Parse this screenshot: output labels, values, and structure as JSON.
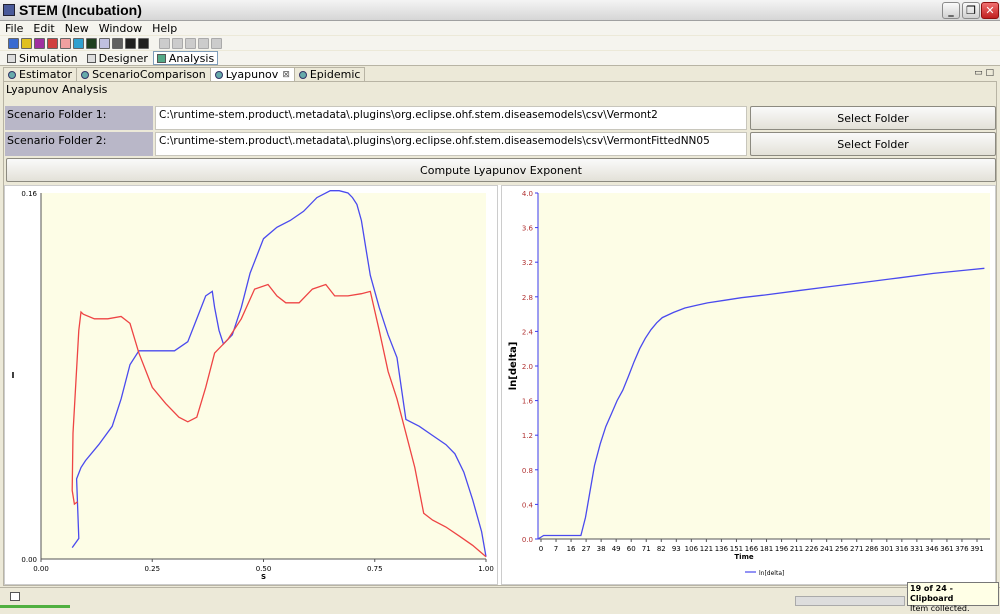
{
  "window": {
    "title": "STEM (Incubation)"
  },
  "menubar": {
    "items": [
      "File",
      "Edit",
      "New",
      "Window",
      "Help"
    ]
  },
  "perspectives": [
    {
      "label": "Simulation",
      "active": false
    },
    {
      "label": "Designer",
      "active": false
    },
    {
      "label": "Analysis",
      "active": true
    }
  ],
  "view_tabs": [
    {
      "label": "Estimator",
      "active": false
    },
    {
      "label": "ScenarioComparison",
      "active": false
    },
    {
      "label": "Lyapunov",
      "active": true
    },
    {
      "label": "Epidemic",
      "active": false
    }
  ],
  "panel": {
    "title": "Lyapunov Analysis",
    "folder1_label": "Scenario Folder 1:",
    "folder1_path": "C:\\runtime-stem.product\\.metadata\\.plugins\\org.eclipse.ohf.stem.diseasemodels\\csv\\Vermont2",
    "folder2_label": "Scenario Folder 2:",
    "folder2_path": "C:\\runtime-stem.product\\.metadata\\.plugins\\org.eclipse.ohf.stem.diseasemodels\\csv\\VermontFittedNN05",
    "select_folder_label": "Select Folder",
    "compute_label": "Compute Lyapunov Exponent"
  },
  "chart_data": [
    {
      "type": "line",
      "xlabel": "S",
      "ylabel": "I",
      "xlim": [
        0,
        1
      ],
      "ylim": [
        0,
        0.16
      ],
      "x_ticks": [
        "0.00",
        "0.25",
        "0.50",
        "0.75",
        "1.00"
      ],
      "y_ticks": [
        "0.00",
        "0.16"
      ],
      "colors": [
        "#4a4aee",
        "#ee4444"
      ],
      "background": "#fdfde6",
      "series": [
        {
          "color": "#4a4aee",
          "x": [
            0.07,
            0.085,
            0.08,
            0.09,
            0.1,
            0.13,
            0.16,
            0.18,
            0.2,
            0.22,
            0.26,
            0.3,
            0.33,
            0.35,
            0.37,
            0.385,
            0.39,
            0.4,
            0.41,
            0.43,
            0.45,
            0.47,
            0.5,
            0.53,
            0.56,
            0.59,
            0.62,
            0.65,
            0.67,
            0.69,
            0.7,
            0.71,
            0.72,
            0.73,
            0.74,
            0.76,
            0.78,
            0.8,
            0.82,
            0.85,
            0.88,
            0.91,
            0.93,
            0.95,
            0.97,
            0.99,
            1.0
          ],
          "y": [
            0.005,
            0.009,
            0.035,
            0.04,
            0.043,
            0.05,
            0.058,
            0.07,
            0.085,
            0.091,
            0.091,
            0.091,
            0.095,
            0.105,
            0.115,
            0.117,
            0.11,
            0.1,
            0.094,
            0.098,
            0.11,
            0.125,
            0.14,
            0.145,
            0.148,
            0.152,
            0.158,
            0.161,
            0.161,
            0.16,
            0.158,
            0.155,
            0.148,
            0.136,
            0.124,
            0.11,
            0.098,
            0.088,
            0.061,
            0.058,
            0.054,
            0.05,
            0.046,
            0.038,
            0.026,
            0.012,
            0.001
          ]
        },
        {
          "color": "#ee4444",
          "x": [
            0.082,
            0.075,
            0.07,
            0.072,
            0.085,
            0.09,
            0.095,
            0.12,
            0.15,
            0.18,
            0.2,
            0.22,
            0.25,
            0.28,
            0.31,
            0.33,
            0.35,
            0.37,
            0.39,
            0.42,
            0.45,
            0.48,
            0.51,
            0.53,
            0.55,
            0.58,
            0.61,
            0.64,
            0.66,
            0.69,
            0.72,
            0.74,
            0.76,
            0.78,
            0.8,
            0.82,
            0.84,
            0.86,
            0.88,
            0.91,
            0.94,
            0.97,
            1.0
          ],
          "y": [
            0.025,
            0.024,
            0.03,
            0.055,
            0.1,
            0.108,
            0.107,
            0.105,
            0.105,
            0.106,
            0.103,
            0.09,
            0.075,
            0.068,
            0.062,
            0.06,
            0.062,
            0.075,
            0.09,
            0.096,
            0.105,
            0.118,
            0.12,
            0.115,
            0.112,
            0.112,
            0.118,
            0.12,
            0.115,
            0.115,
            0.116,
            0.117,
            0.1,
            0.082,
            0.07,
            0.055,
            0.04,
            0.02,
            0.017,
            0.014,
            0.01,
            0.006,
            0.001
          ]
        }
      ]
    },
    {
      "type": "line",
      "xlabel": "Time",
      "ylabel": "ln[delta]",
      "ylim": [
        0,
        4
      ],
      "xlim": [
        0,
        400
      ],
      "x_ticks": [
        "0",
        "7",
        "16",
        "27",
        "38",
        "49",
        "60",
        "71",
        "82",
        "93",
        "106",
        "121",
        "136",
        "151",
        "166",
        "181",
        "196",
        "211",
        "226",
        "241",
        "256",
        "271",
        "286",
        "301",
        "316",
        "331",
        "346",
        "361",
        "376",
        "391"
      ],
      "y_ticks": [
        "0.0",
        "0.4",
        "0.8",
        "1.2",
        "1.6",
        "2.0",
        "2.4",
        "2.8",
        "3.2",
        "3.6",
        "4.0"
      ],
      "legend": "ln[delta]",
      "legend_placement": "bottom-center",
      "colors": [
        "#4a4aee"
      ],
      "background": "#fdfde6",
      "series": [
        {
          "name": "ln[delta]",
          "color": "#4a4aee",
          "x": [
            0,
            5,
            10,
            20,
            30,
            38,
            42,
            46,
            50,
            55,
            60,
            65,
            70,
            75,
            80,
            85,
            90,
            95,
            100,
            105,
            110,
            120,
            130,
            140,
            150,
            165,
            180,
            200,
            230,
            260,
            290,
            320,
            350,
            380,
            395
          ],
          "y": [
            0.0,
            0.04,
            0.04,
            0.04,
            0.04,
            0.04,
            0.25,
            0.55,
            0.85,
            1.1,
            1.3,
            1.45,
            1.6,
            1.72,
            1.88,
            2.05,
            2.2,
            2.32,
            2.42,
            2.5,
            2.56,
            2.62,
            2.67,
            2.7,
            2.73,
            2.76,
            2.79,
            2.82,
            2.87,
            2.92,
            2.97,
            3.02,
            3.07,
            3.11,
            3.13
          ]
        }
      ]
    }
  ],
  "statusbar": {
    "toast_title": "19 of 24 - Clipboard",
    "toast_text": "Item collected."
  }
}
